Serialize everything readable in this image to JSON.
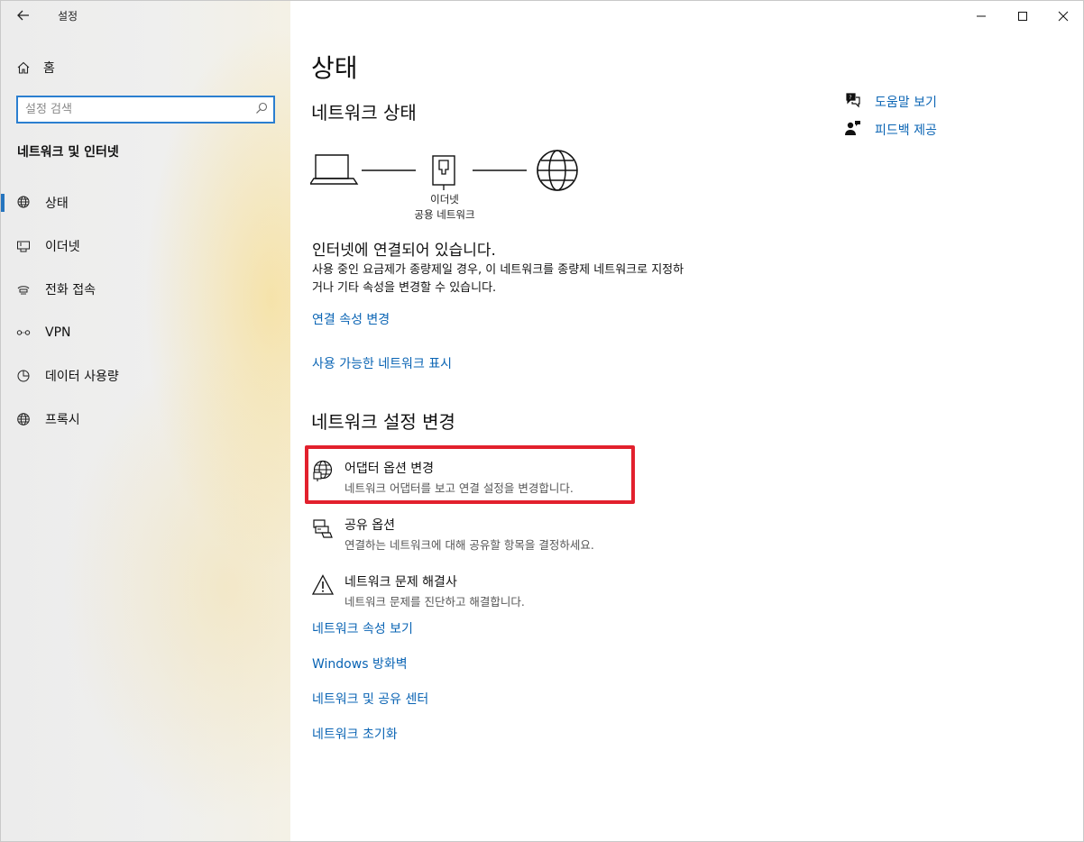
{
  "window": {
    "title": "설정",
    "controls": [
      "minimize",
      "maximize",
      "close"
    ]
  },
  "sidebar": {
    "home_label": "홈",
    "search_placeholder": "설정 검색",
    "section_title": "네트워크 및 인터넷",
    "items": [
      {
        "label": "상태",
        "icon": "status-globe-icon",
        "active": true
      },
      {
        "label": "이더넷",
        "icon": "ethernet-icon",
        "active": false
      },
      {
        "label": "전화 접속",
        "icon": "dialup-icon",
        "active": false
      },
      {
        "label": "VPN",
        "icon": "vpn-icon",
        "active": false
      },
      {
        "label": "데이터 사용량",
        "icon": "data-usage-icon",
        "active": false
      },
      {
        "label": "프록시",
        "icon": "proxy-globe-icon",
        "active": false
      }
    ]
  },
  "main": {
    "title": "상태",
    "network_status_heading": "네트워크 상태",
    "diagram": {
      "adapter_name": "이더넷",
      "network_type": "공용 네트워크"
    },
    "status_title": "인터넷에 연결되어 있습니다.",
    "status_desc": "사용 중인 요금제가 종량제일 경우, 이 네트워크를 종량제 네트워크로 지정하거나 기타 속성을 변경할 수 있습니다.",
    "links_top": {
      "change_props": "연결 속성 변경",
      "show_networks": "사용 가능한 네트워크 표시"
    },
    "change_settings_heading": "네트워크 설정 변경",
    "options": [
      {
        "title": "어댑터 옵션 변경",
        "desc": "네트워크 어댑터를 보고 연결 설정을 변경합니다.",
        "icon": "adapter-globe-icon",
        "highlighted": true
      },
      {
        "title": "공유 옵션",
        "desc": "연결하는 네트워크에 대해 공유할 항목을 결정하세요.",
        "icon": "sharing-icon",
        "highlighted": false
      },
      {
        "title": "네트워크 문제 해결사",
        "desc": "네트워크 문제를 진단하고 해결합니다.",
        "icon": "warning-icon",
        "highlighted": false
      }
    ],
    "links_bottom": {
      "view_props": "네트워크 속성 보기",
      "firewall": "Windows 방화벽",
      "sharing_center": "네트워크 및 공유 센터",
      "reset": "네트워크 초기화"
    }
  },
  "help": {
    "get_help": "도움말 보기",
    "feedback": "피드백 제공"
  },
  "colors": {
    "accent": "#2675bf",
    "link": "#0a64b4",
    "highlight_border": "#e2202d"
  }
}
